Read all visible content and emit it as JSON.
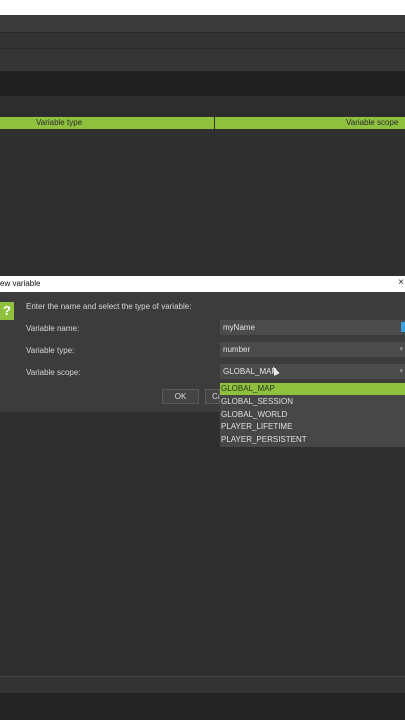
{
  "table": {
    "col_type": "Variable type",
    "col_scope": "Variable scope"
  },
  "dialog": {
    "title": "ew variable",
    "close": "×",
    "help": "?",
    "instruction": "Enter the name and select the type of variable:",
    "name_label": "Variable name:",
    "type_label": "Variable type:",
    "scope_label": "Variable scope:",
    "name_value": "myName",
    "type_value": "number",
    "scope_value": "GLOBAL_MAP",
    "ok_label": "OK",
    "cancel_label": "Ca"
  },
  "scope_options": [
    "GLOBAL_MAP",
    "GLOBAL_SESSION",
    "GLOBAL_WORLD",
    "PLAYER_LIFETIME",
    "PLAYER_PERSISTENT"
  ],
  "colors": {
    "accent": "#8fc13f",
    "panel": "#3c3c3c",
    "background": "#2f2f2f"
  }
}
